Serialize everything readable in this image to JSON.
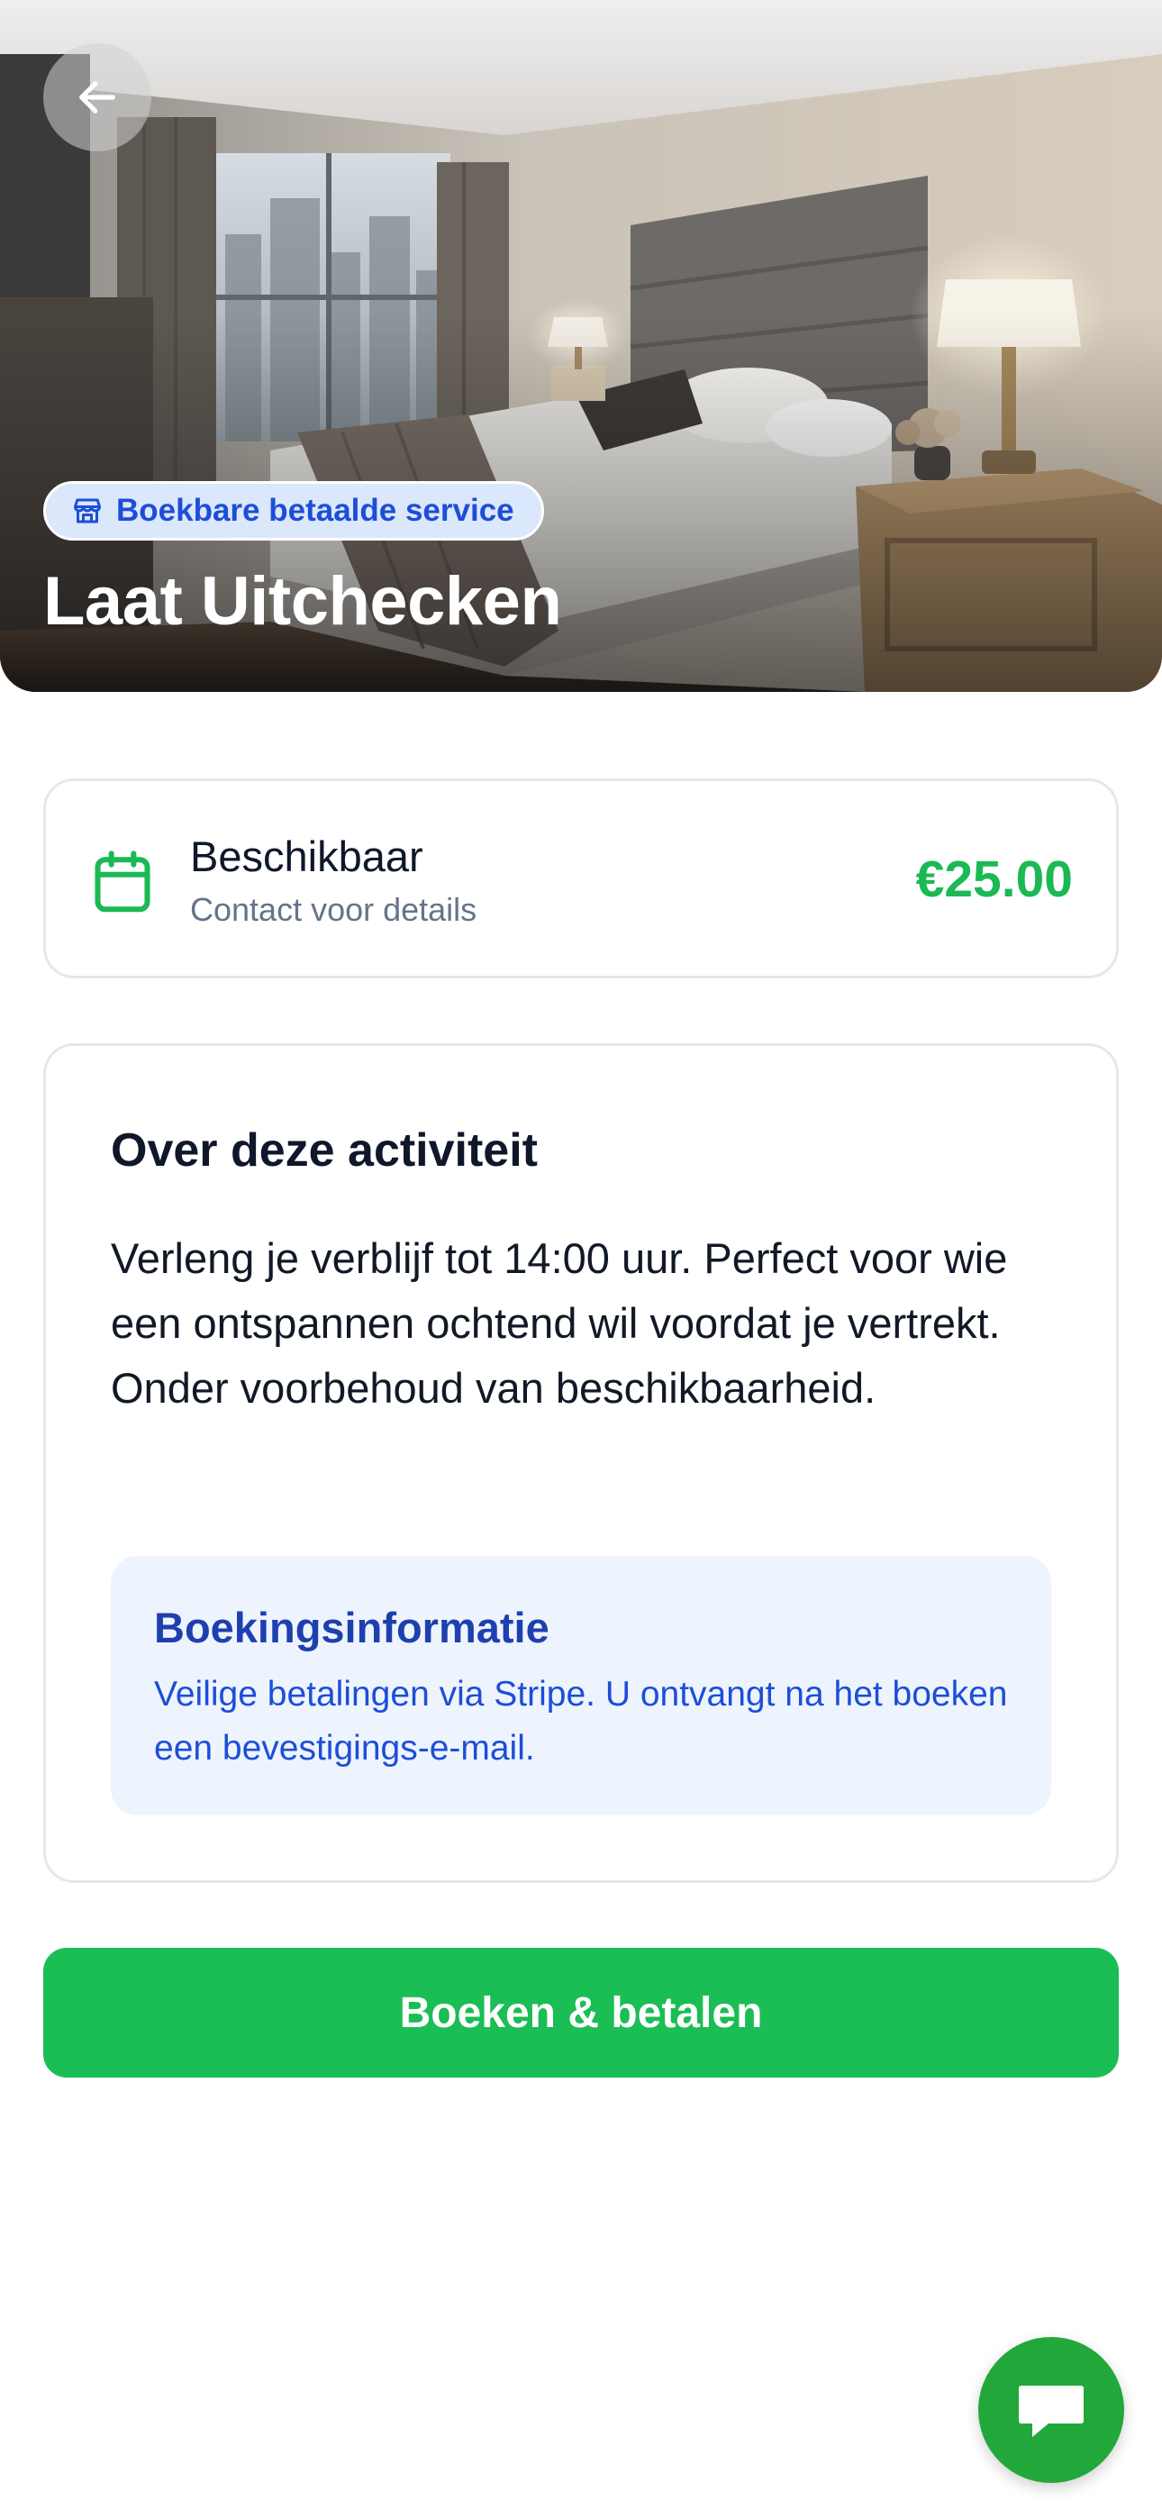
{
  "hero": {
    "image": "hotel-room-photo",
    "badge_icon": "store-icon",
    "badge_label": "Boekbare betaalde service",
    "title": "Laat Uitchecken"
  },
  "availability": {
    "icon": "calendar-icon",
    "title": "Beschikbaar",
    "subtitle": "Contact voor details",
    "price": "€25.00"
  },
  "about": {
    "title": "Over deze activiteit",
    "description": "Verleng je verblijf tot 14:00 uur. Perfect voor wie een ontspannen ochtend wil voordat je vertrekt. Onder voorbehoud van beschikbaarheid.",
    "info_title": "Boekingsinformatie",
    "info_text": "Veilige betalingen via Stripe. U ontvangt na het boeken een bevestigings-e-mail."
  },
  "actions": {
    "book_label": "Boeken & betalen",
    "back_icon": "arrow-left-icon",
    "chat_icon": "chat-icon"
  },
  "colors": {
    "accent_green": "#1bbd55",
    "price_green": "#1bb954",
    "info_blue": "#1d4ed8",
    "info_bg": "#eef4fe"
  }
}
